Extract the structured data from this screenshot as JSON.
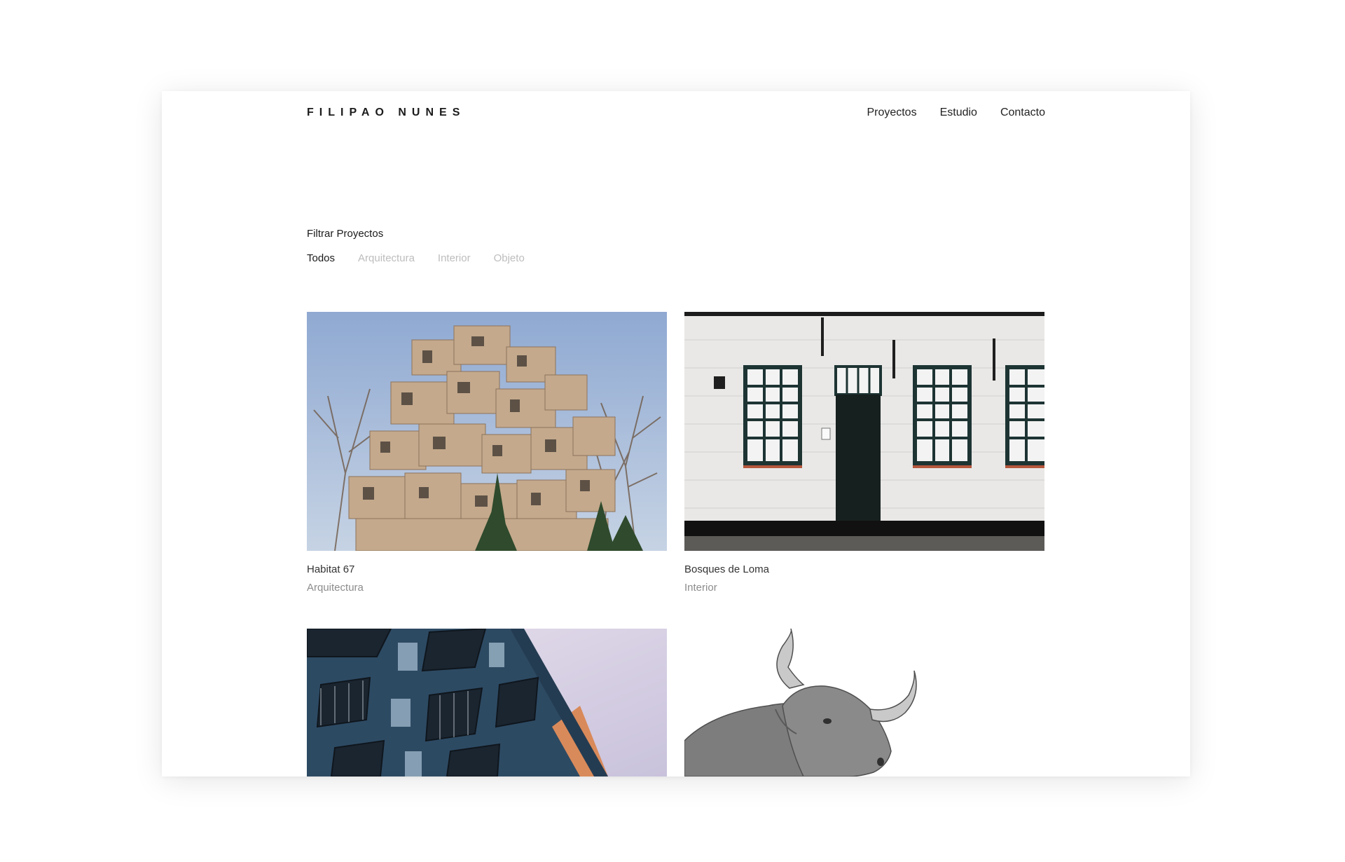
{
  "header": {
    "brand": "FILIPAO NUNES",
    "nav": [
      "Proyectos",
      "Estudio",
      "Contacto"
    ]
  },
  "filter": {
    "title": "Filtrar Proyectos",
    "options": [
      "Todos",
      "Arquitectura",
      "Interior",
      "Objeto"
    ],
    "active": "Todos"
  },
  "projects": [
    {
      "name": "Habitat 67",
      "category": "Arquitectura"
    },
    {
      "name": "Bosques de Loma",
      "category": "Interior"
    }
  ],
  "colors": {
    "text": "#1a1a1a",
    "muted": "#8c8c8c",
    "filter_inactive": "#bdbdbd"
  }
}
